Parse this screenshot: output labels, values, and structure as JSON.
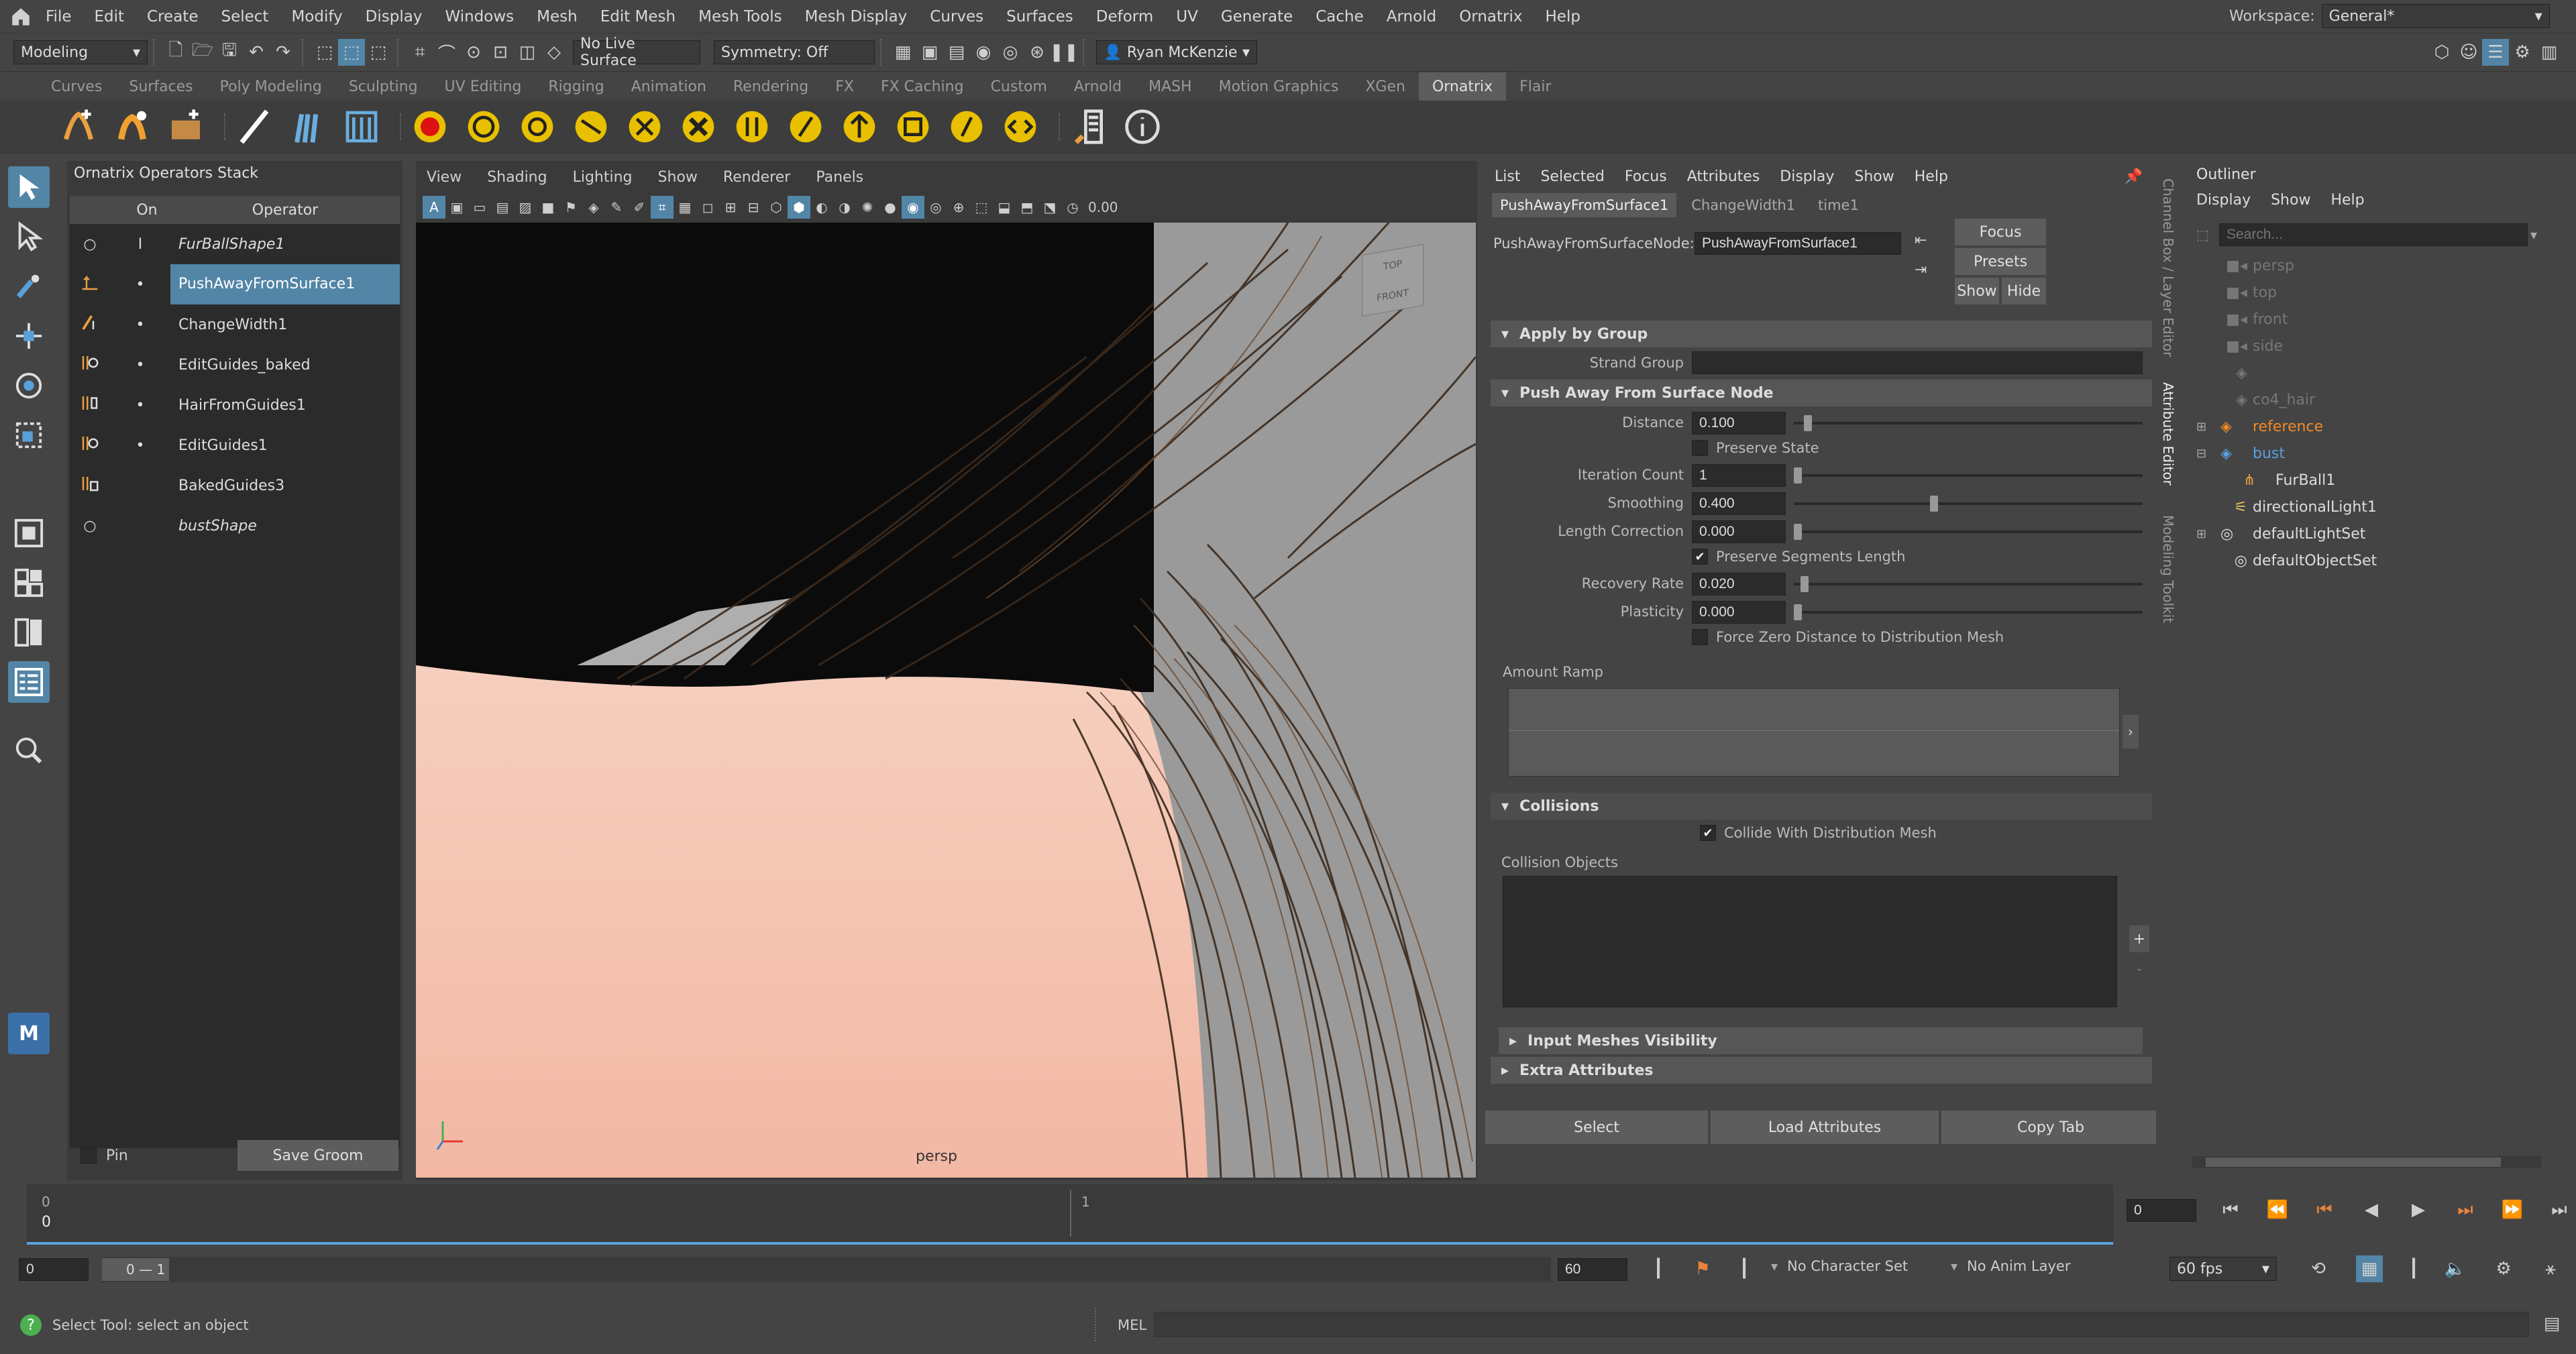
{
  "menubar": {
    "items": [
      "File",
      "Edit",
      "Create",
      "Select",
      "Modify",
      "Display",
      "Windows",
      "Mesh",
      "Edit Mesh",
      "Mesh Tools",
      "Mesh Display",
      "Curves",
      "Surfaces",
      "Deform",
      "UV",
      "Generate",
      "Cache",
      "Arnold",
      "Ornatrix",
      "Help"
    ],
    "workspace_label": "Workspace:",
    "workspace_value": "General*"
  },
  "statusline": {
    "mode": "Modeling",
    "live_surface": "No Live Surface",
    "symmetry": "Symmetry: Off",
    "user": "Ryan McKenzie"
  },
  "shelf": {
    "tabs": [
      "Curves",
      "Surfaces",
      "Poly Modeling",
      "Sculpting",
      "UV Editing",
      "Rigging",
      "Animation",
      "Rendering",
      "FX",
      "FX Caching",
      "Custom",
      "Arnold",
      "MASH",
      "Motion Graphics",
      "XGen",
      "Ornatrix",
      "Flair"
    ],
    "active": "Ornatrix"
  },
  "operators": {
    "title": "Ornatrix Operators Stack",
    "col_on": "On",
    "col_operator": "Operator",
    "rows": [
      {
        "name": "FurBallShape1",
        "italic": true,
        "on": "I"
      },
      {
        "name": "PushAwayFromSurface1",
        "italic": false,
        "on": "•",
        "selected": true
      },
      {
        "name": "ChangeWidth1",
        "italic": false,
        "on": "•"
      },
      {
        "name": "EditGuides_baked",
        "italic": false,
        "on": "•"
      },
      {
        "name": "HairFromGuides1",
        "italic": false,
        "on": "•"
      },
      {
        "name": "EditGuides1",
        "italic": false,
        "on": "•"
      },
      {
        "name": "BakedGuides3",
        "italic": false,
        "on": ""
      },
      {
        "name": "bustShape",
        "italic": true,
        "on": ""
      }
    ],
    "pin_label": "Pin",
    "save_groom": "Save Groom"
  },
  "viewport": {
    "menu": [
      "View",
      "Shading",
      "Lighting",
      "Show",
      "Renderer",
      "Panels"
    ],
    "exposure": "0.00",
    "camera_label": "persp",
    "viewcube_top": "TOP",
    "viewcube_front": "FRONT"
  },
  "attr_editor": {
    "menu": [
      "List",
      "Selected",
      "Focus",
      "Attributes",
      "Display",
      "Show",
      "Help"
    ],
    "tabs": [
      "PushAwayFromSurface1",
      "ChangeWidth1",
      "time1"
    ],
    "node_label": "PushAwayFromSurfaceNode:",
    "node_value": "PushAwayFromSurface1",
    "focus": "Focus",
    "presets": "Presets",
    "show": "Show",
    "hide": "Hide",
    "sec_apply": "Apply by Group",
    "strand_group": "Strand Group",
    "sec_push": "Push Away From Surface Node",
    "distance_label": "Distance",
    "distance": "0.100",
    "distance_frac": 0.03,
    "preserve_state": "Preserve State",
    "iter_label": "Iteration Count",
    "iter": "1",
    "iter_frac": 0.0,
    "smooth_label": "Smoothing",
    "smooth": "0.400",
    "smooth_frac": 0.4,
    "lencorr_label": "Length Correction",
    "lencorr": "0.000",
    "lencorr_frac": 0.0,
    "preserve_seg": "Preserve Segments Length",
    "recovery_label": "Recovery Rate",
    "recovery": "0.020",
    "recovery_frac": 0.02,
    "plasticity_label": "Plasticity",
    "plasticity": "0.000",
    "plasticity_frac": 0.0,
    "force_zero": "Force Zero Distance to Distribution Mesh",
    "amount_ramp": "Amount Ramp",
    "sec_collisions": "Collisions",
    "collide": "Collide With Distribution Mesh",
    "collision_objects": "Collision Objects",
    "sec_input": "Input Meshes Visibility",
    "sec_extra": "Extra Attributes",
    "btn_select": "Select",
    "btn_load": "Load Attributes",
    "btn_copy": "Copy Tab"
  },
  "sidetabs": {
    "channel_box": "Channel Box / Layer Editor",
    "attribute_editor": "Attribute Editor",
    "modeling_toolkit": "Modeling Toolkit"
  },
  "outliner": {
    "title": "Outliner",
    "menu": [
      "Display",
      "Show",
      "Help"
    ],
    "search_placeholder": "Search...",
    "items": [
      {
        "label": "persp",
        "dim": true,
        "indent": 0
      },
      {
        "label": "top",
        "dim": true,
        "indent": 0
      },
      {
        "label": "front",
        "dim": true,
        "indent": 0
      },
      {
        "label": "side",
        "dim": true,
        "indent": 0
      },
      {
        "label": "",
        "dim": true,
        "indent": 0
      },
      {
        "label": "co4_hair",
        "dim": true,
        "indent": 0
      },
      {
        "label": "reference",
        "color": "orange",
        "indent": 0,
        "expand": true
      },
      {
        "label": "bust",
        "color": "blue",
        "indent": 0,
        "expand": true
      },
      {
        "label": "FurBall1",
        "indent": 1
      },
      {
        "label": "directionalLight1",
        "indent": 0
      },
      {
        "label": "defaultLightSet",
        "indent": 0,
        "expand": true
      },
      {
        "label": "defaultObjectSet",
        "indent": 0
      }
    ]
  },
  "timeline": {
    "tick_start": "0",
    "tick_label_start": "0",
    "tick_mid": "1",
    "current_frame": "0"
  },
  "range": {
    "start": "0",
    "inner_start": "0",
    "range_label": "0 — 1",
    "end": "60",
    "character_set": "No Character Set",
    "anim_layer": "No Anim Layer",
    "fps": "60 fps"
  },
  "cmdline": {
    "help": "Select Tool: select an object",
    "mel": "MEL"
  },
  "colors": {
    "accent": "#5285a6",
    "panel": "#444444",
    "field": "#2b2b2b",
    "skin": "#f2c4b4"
  }
}
